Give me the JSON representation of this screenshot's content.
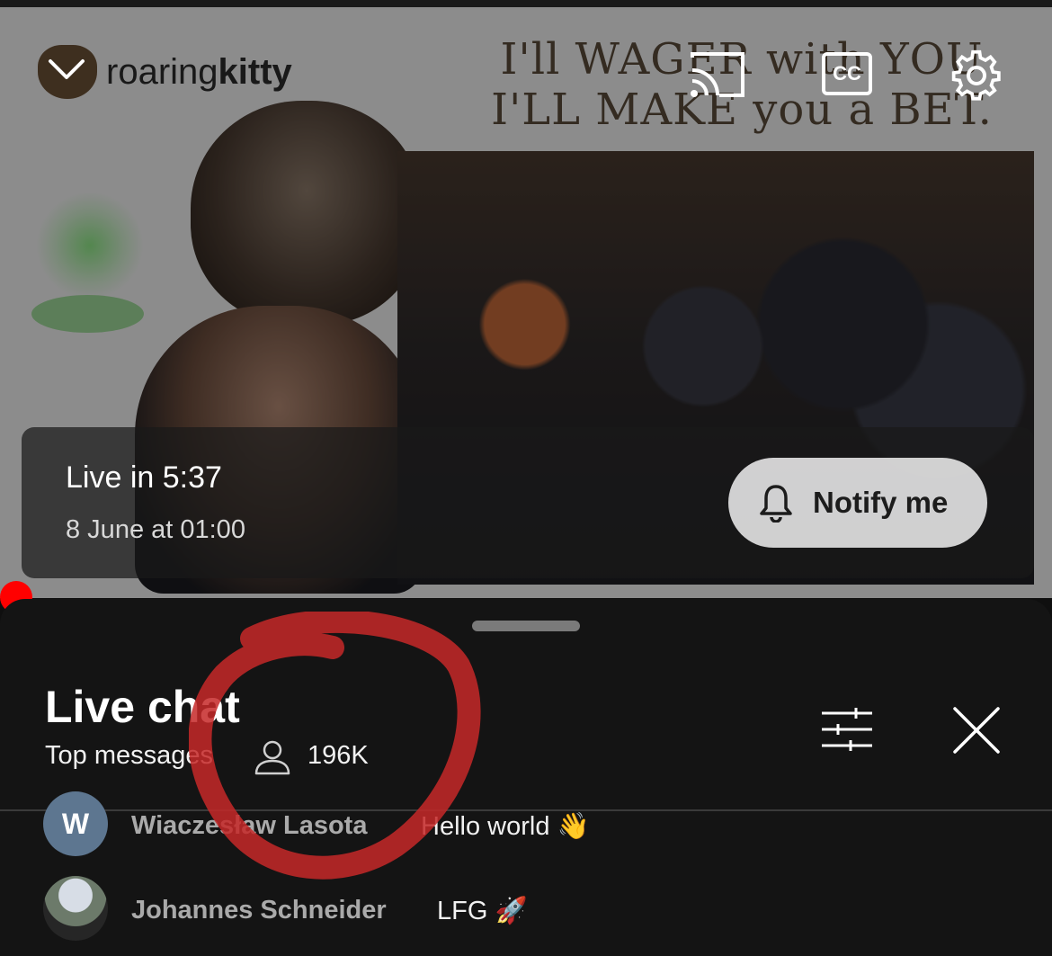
{
  "video": {
    "channel_prefix": "roaring",
    "channel_bold": "kitty",
    "headline_line1": "I'll WAGER with YOU",
    "headline_line2": "I'LL MAKE you a BET.",
    "top_icons": [
      "cast-icon",
      "captions-icon",
      "settings-gear-icon"
    ],
    "cc_label": "CC"
  },
  "live_banner": {
    "live_in": "Live in 5:37",
    "date": "8 June at 01:00",
    "notify_label": "Notify me"
  },
  "chat": {
    "title": "Live chat",
    "mode": "Top messages",
    "viewers": "196K",
    "messages": [
      {
        "avatar_letter": "W",
        "author": "Wiaczesław Lasota",
        "text": "Hello world 👋"
      },
      {
        "avatar_letter": "",
        "author": "Johannes Schneider",
        "text": "LFG 🚀"
      }
    ]
  },
  "colors": {
    "accent_red": "#ff0000",
    "panel_bg": "#141414",
    "annotation_red": "#c62828"
  }
}
